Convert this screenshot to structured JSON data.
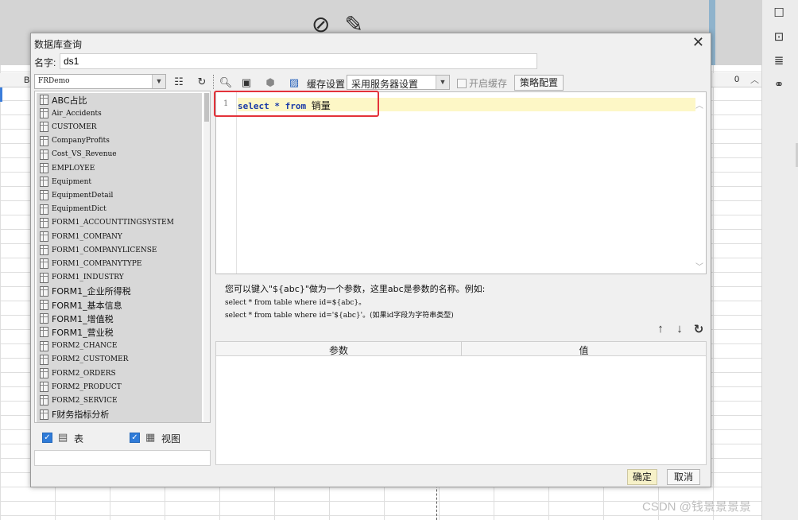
{
  "dialog": {
    "title": "数据库查询",
    "close_icon": "close-icon",
    "name_label": "名字:",
    "name_value": "ds1"
  },
  "background": {
    "column_labels": [
      "B",
      "0"
    ]
  },
  "connection": {
    "selected": "FRDemo",
    "icons": [
      "chevron-down-icon",
      "edit-sql-icon",
      "refresh-icon"
    ]
  },
  "tables": [
    {
      "label": "ABC占比"
    },
    {
      "label": "Air_Accidents"
    },
    {
      "label": "CUSTOMER"
    },
    {
      "label": "CompanyProfits"
    },
    {
      "label": "Cost_VS_Revenue"
    },
    {
      "label": "EMPLOYEE"
    },
    {
      "label": "Equipment"
    },
    {
      "label": "EquipmentDetail"
    },
    {
      "label": "EquipmentDict"
    },
    {
      "label": "FORM1_ACCOUNTTINGSYSTEM"
    },
    {
      "label": "FORM1_COMPANY"
    },
    {
      "label": "FORM1_COMPANYLICENSE"
    },
    {
      "label": "FORM1_COMPANYTYPE"
    },
    {
      "label": "FORM1_INDUSTRY"
    },
    {
      "label": "FORM1_企业所得税"
    },
    {
      "label": "FORM1_基本信息"
    },
    {
      "label": "FORM1_增值税"
    },
    {
      "label": "FORM1_营业税"
    },
    {
      "label": "FORM2_CHANCE"
    },
    {
      "label": "FORM2_CUSTOMER"
    },
    {
      "label": "FORM2_ORDERS"
    },
    {
      "label": "FORM2_PRODUCT"
    },
    {
      "label": "FORM2_SERVICE"
    },
    {
      "label": "F财务指标分析"
    }
  ],
  "filters": {
    "table_label": "表",
    "table_checked": true,
    "view_label": "视图",
    "view_checked": true
  },
  "toolbar": {
    "cache_label": "缓存设置",
    "cache_select": "采用服务器设置",
    "enable_cache_label": "开启缓存",
    "strategy_button": "策略配置"
  },
  "editor": {
    "line_number": "1",
    "keyword_select": "select",
    "star": "*",
    "keyword_from": "from",
    "table": "销量"
  },
  "hint": {
    "line1": "您可以键入\"${abc}\"做为一个参数，这里abc是参数的名称。例如:",
    "line2": "select * from table where id=${abc}。",
    "line3": "select * from table where id='${abc}'。(如果id字段为字符串类型)"
  },
  "params": {
    "col_param": "参数",
    "col_value": "值"
  },
  "buttons": {
    "ok": "确定",
    "cancel": "取消"
  },
  "watermark": "CSDN @钱景景景景"
}
